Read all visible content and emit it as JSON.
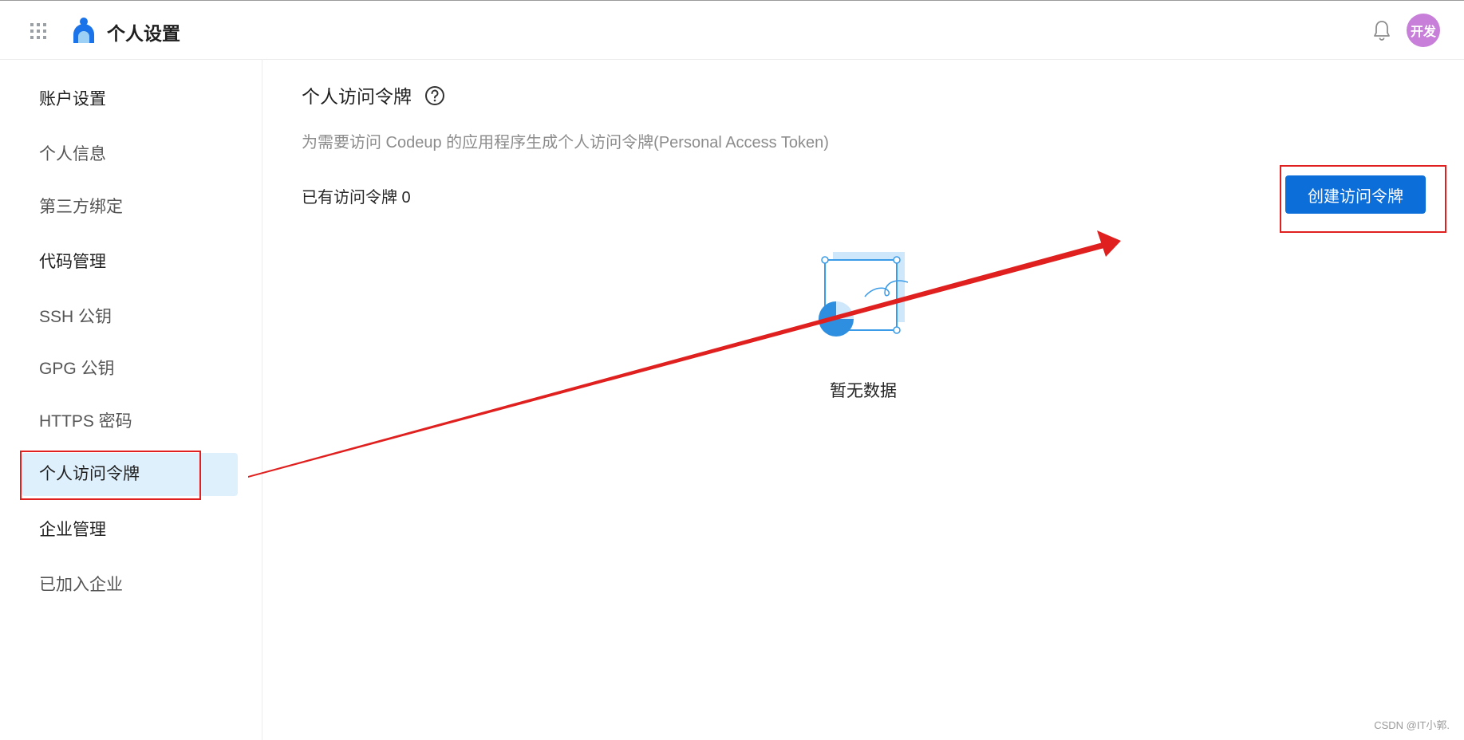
{
  "header": {
    "apps_icon": "grid-dots-icon",
    "logo_icon": "user-profile-logo",
    "title": "个人设置",
    "bell_icon": "bell-icon",
    "avatar_text": "开发",
    "avatar_color": "#c77fd9"
  },
  "sidebar": {
    "items": [
      {
        "label": "账户设置"
      },
      {
        "label": "个人信息"
      },
      {
        "label": "第三方绑定"
      },
      {
        "label": "代码管理"
      },
      {
        "label": "SSH 公钥"
      },
      {
        "label": "GPG 公钥"
      },
      {
        "label": "HTTPS 密码"
      },
      {
        "label": "个人访问令牌",
        "active": true
      },
      {
        "label": "企业管理"
      },
      {
        "label": "已加入企业"
      }
    ]
  },
  "main": {
    "title": "个人访问令牌",
    "help_icon": "question-circle-icon",
    "description": "为需要访问 Codeup 的应用程序生成个人访问令牌(Personal Access Token)",
    "token_count_label": "已有访问令牌 0",
    "create_button_label": "创建访问令牌",
    "empty_icon": "empty-data-illustration",
    "empty_text": "暂无数据"
  },
  "colors": {
    "accent": "#0c6ed9",
    "active_bg": "#dff0fd",
    "annotation_red": "#e0201f"
  },
  "watermark": "CSDN @IT小郭."
}
